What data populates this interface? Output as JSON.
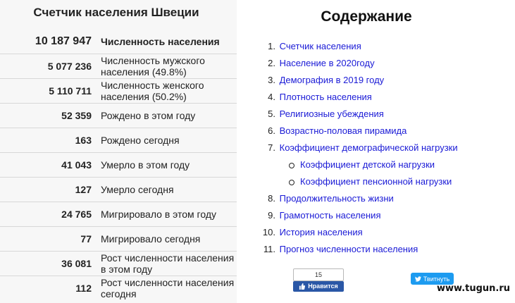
{
  "counter": {
    "title": "Счетчик населения Швеции",
    "rows": [
      {
        "value": "10 187 947",
        "label": "Численность населения"
      },
      {
        "value": "5 077 236",
        "label": "Численность мужского населения (49.8%)"
      },
      {
        "value": "5 110 711",
        "label": "Численность женского населения (50.2%)"
      },
      {
        "value": "52 359",
        "label": "Рождено в этом году"
      },
      {
        "value": "163",
        "label": "Рождено сегодня"
      },
      {
        "value": "41 043",
        "label": "Умерло в этом году"
      },
      {
        "value": "127",
        "label": "Умерло сегодня"
      },
      {
        "value": "24 765",
        "label": "Мигрировало в этом году"
      },
      {
        "value": "77",
        "label": "Мигрировало сегодня"
      },
      {
        "value": "36 081",
        "label": "Рост численности населения в этом году"
      },
      {
        "value": "112",
        "label": "Рост численности населения сегодня"
      }
    ]
  },
  "toc": {
    "title": "Содержание",
    "items": [
      {
        "num": "1.",
        "label": "Счетчик населения"
      },
      {
        "num": "2.",
        "label": "Население в 2020году"
      },
      {
        "num": "3.",
        "label": "Демография в 2019 году"
      },
      {
        "num": "4.",
        "label": "Плотность населения"
      },
      {
        "num": "5.",
        "label": "Религиозные убеждения"
      },
      {
        "num": "6.",
        "label": "Возрастно-половая пирамида"
      },
      {
        "num": "7.",
        "label": "Коэффициент демографической нагрузки"
      },
      {
        "num": "8.",
        "label": "Продолжительность жизни"
      },
      {
        "num": "9.",
        "label": "Грамотность населения"
      },
      {
        "num": "10.",
        "label": "История населения"
      },
      {
        "num": "11.",
        "label": "Прогноз численности населения"
      }
    ],
    "subitems": [
      {
        "label": "Коэффициент детской нагрузки"
      },
      {
        "label": "Коэффициент пенсионной нагрузки"
      }
    ]
  },
  "social": {
    "like_count": "15",
    "like_label": "Нравится",
    "tweet_label": "Твитнуть",
    "like_color": "#2a57a6",
    "tweet_color": "#1d9bf0"
  },
  "watermark": "www.tugun.ru",
  "colors": {
    "link": "#1a1ad6",
    "panel_bg": "#f7f7f7"
  }
}
